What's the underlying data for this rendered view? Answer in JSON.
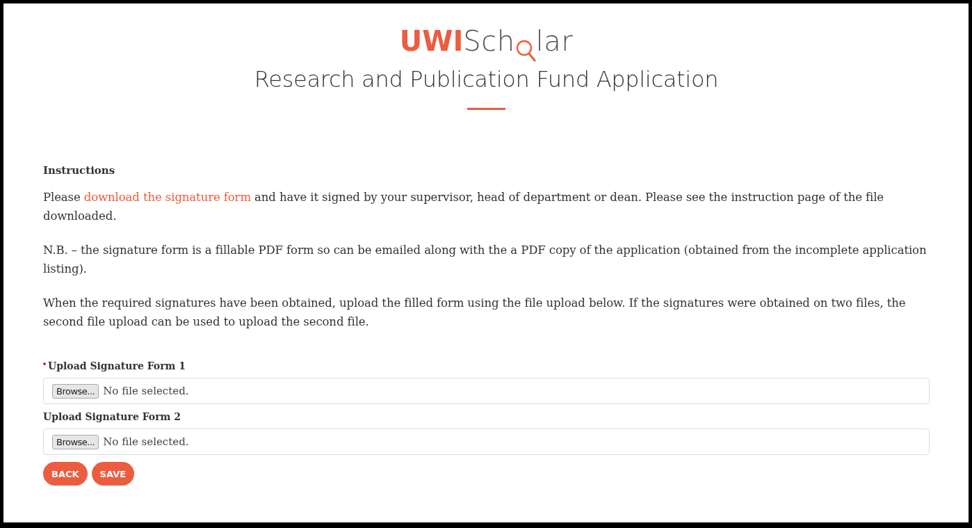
{
  "logo": {
    "strong": "UWI",
    "light_start": "Sch",
    "light_end": "lar"
  },
  "title": "Research and Publication Fund Application",
  "instructions": {
    "heading": "Instructions",
    "paragraphs": [
      {
        "before": "Please ",
        "link": "download the signature form",
        "after": " and have it signed by your supervisor, head of department or dean. Please see the instruction page of the file downloaded."
      },
      {
        "before": "N.B. – the signature form is a fillable PDF form so can be emailed along with the a PDF copy of the application (obtained from the incomplete application listing)."
      },
      {
        "before": "When the required signatures have been obtained, upload the filled form using the file upload below. If the signatures were obtained on two files, the second file upload can be used to upload the second file."
      }
    ]
  },
  "uploads": [
    {
      "label": "Upload Signature Form 1",
      "required": true,
      "button": "Browse...",
      "status": "No file selected."
    },
    {
      "label": "Upload Signature Form 2",
      "required": false,
      "button": "Browse...",
      "status": "No file selected."
    }
  ],
  "buttons": [
    "BACK",
    "SAVE"
  ]
}
